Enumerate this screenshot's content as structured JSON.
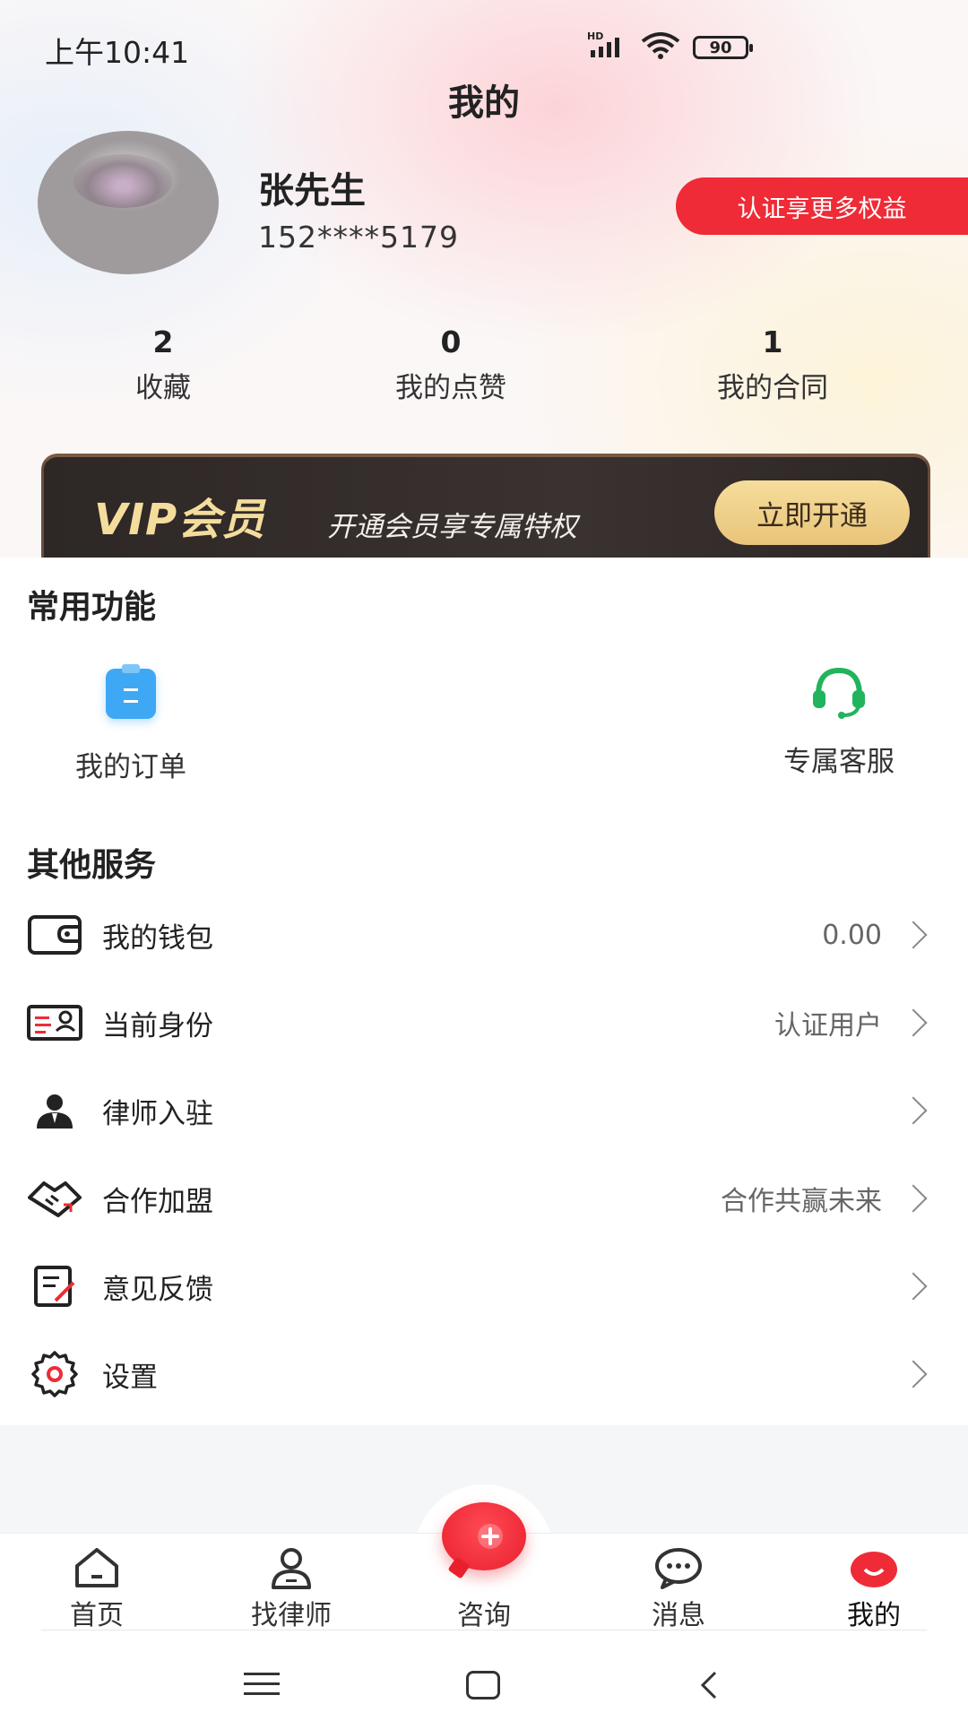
{
  "status_bar": {
    "time": "上午10:41",
    "network": "HD",
    "battery": "90"
  },
  "page_title": "我的",
  "profile": {
    "name": "张先生",
    "phone": "152****5179",
    "cert_button": "认证享更多权益"
  },
  "stats": [
    {
      "value": "2",
      "label": "收藏"
    },
    {
      "value": "0",
      "label": "我的点赞"
    },
    {
      "value": "1",
      "label": "我的合同"
    }
  ],
  "vip": {
    "title": "VIP会员",
    "subtitle": "开通会员享专属特权",
    "button": "立即开通"
  },
  "common_functions": {
    "title": "常用功能",
    "items": [
      {
        "label": "我的订单",
        "icon": "order-icon"
      },
      {
        "label": "专属客服",
        "icon": "headset-icon"
      }
    ]
  },
  "other_services": {
    "title": "其他服务",
    "rows": [
      {
        "label": "我的钱包",
        "value": "0.00",
        "icon": "wallet-icon"
      },
      {
        "label": "当前身份",
        "value": "认证用户",
        "icon": "id-card-icon"
      },
      {
        "label": "律师入驻",
        "value": "",
        "icon": "lawyer-icon"
      },
      {
        "label": "合作加盟",
        "value": "合作共赢未来",
        "icon": "handshake-icon"
      },
      {
        "label": "意见反馈",
        "value": "",
        "icon": "feedback-icon"
      },
      {
        "label": "设置",
        "value": "",
        "icon": "gear-icon"
      }
    ]
  },
  "tabbar": {
    "items": [
      {
        "label": "首页",
        "icon": "home-icon"
      },
      {
        "label": "找律师",
        "icon": "person-icon"
      },
      {
        "label": "咨询",
        "icon": "consult-icon"
      },
      {
        "label": "消息",
        "icon": "message-icon"
      },
      {
        "label": "我的",
        "icon": "profile-icon"
      }
    ],
    "active": "我的"
  },
  "colors": {
    "accent_red": "#ee2b36",
    "vip_gold": "#f4dd9c",
    "vip_dark": "#2d2725",
    "order_blue": "#3ea8f5",
    "service_green": "#22b35e"
  }
}
